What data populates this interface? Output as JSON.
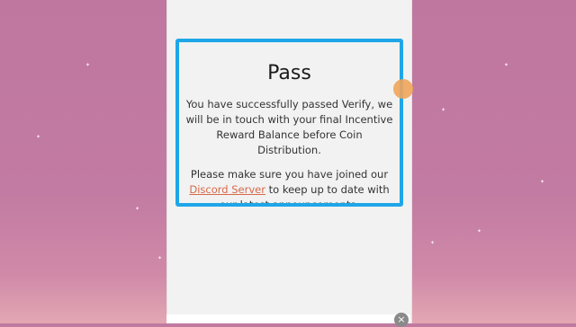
{
  "card": {
    "title": "Pass",
    "message": "You have successfully passed Verify, we will be in touch with your final Incentive Reward Balance before Coin Distribution.",
    "join_prefix": "Please make sure you have joined our",
    "discord_link": "Discord Server",
    "join_suffix": "to keep up to date with our latest announcements."
  },
  "close_label": "×",
  "colors": {
    "card_border": "#1ea6e8",
    "link": "#d9694a",
    "background": "#c07aa0"
  }
}
